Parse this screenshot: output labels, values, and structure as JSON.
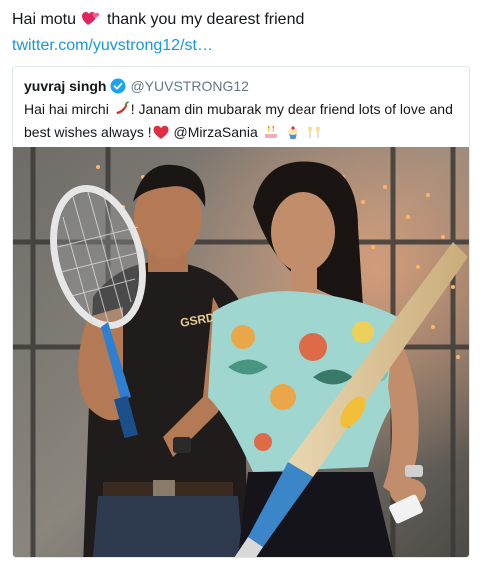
{
  "tweet": {
    "text_before": "Hai motu",
    "text_after": "thank you my dearest friend",
    "heart_icon": "two-hearts-icon",
    "link_text": "twitter.com/yuvstrong12/st…"
  },
  "quoted_tweet": {
    "author_name": "yuvraj singh",
    "verified_icon": "verified-badge-icon",
    "handle": "@YUVSTRONG12",
    "line1_a": "Hai hai mirchi",
    "line1_b": "! Janam din mubarak my dear friend lots of love and",
    "line2_a": "best wishes always !",
    "line2_b": "@MirzaSania",
    "emojis": [
      "chili-pepper-icon",
      "red-heart-icon",
      "birthday-cake-icon",
      "cupcake-icon",
      "clinking-glasses-icon"
    ],
    "photo": {
      "description_icon": "photo-icon",
      "shirt_text": "GSRD"
    }
  },
  "colors": {
    "link": "#1b95e0",
    "handle": "#657786",
    "verified": "#1da1f2",
    "border": "#e1e8ed",
    "heart": "#e0245e"
  }
}
